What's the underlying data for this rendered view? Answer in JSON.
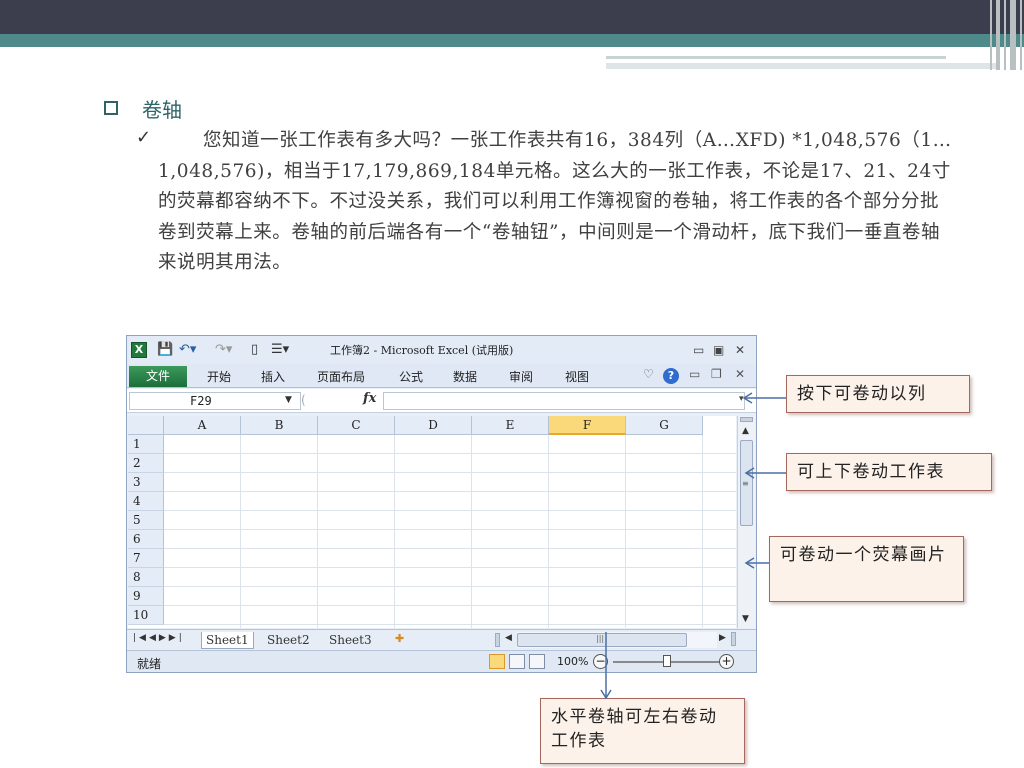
{
  "slide": {
    "title": "卷轴",
    "paragraph": "您知道一张工作表有多大吗？一张工作表共有16，384列（A…XFD) *1,048,576（1… 1,048,576)，相当于17,179,869,184单元格。这么大的一张工作表，不论是17、21、24寸的荧幕都容纳不下。不过没关系，我们可以利用工作簿视窗的卷轴，将工作表的各个部分分批卷到荧幕上来。卷轴的前后端各有一个“卷轴钮”，中间则是一个滑动杆，底下我们一垂直卷轴来说明其用法。",
    "check_glyph": "✓"
  },
  "excel": {
    "title": "工作簿2 - Microsoft Excel (试用版)",
    "logo": "X",
    "file_tab": "文件",
    "ribbon_tabs": [
      "开始",
      "插入",
      "页面布局",
      "公式",
      "数据",
      "审阅",
      "视图"
    ],
    "name_box": "F29",
    "fx_label": "fx",
    "columns": [
      "A",
      "B",
      "C",
      "D",
      "E",
      "F",
      "G"
    ],
    "selected_column": "F",
    "rows": [
      "1",
      "2",
      "3",
      "4",
      "5",
      "6",
      "7",
      "8",
      "9",
      "10"
    ],
    "sheet_tabs": [
      "Sheet1",
      "Sheet2",
      "Sheet3"
    ],
    "active_sheet": "Sheet1",
    "status": "就绪",
    "zoom": "100%",
    "zoom_level": 0.5
  },
  "callouts": {
    "column_scroll": "按下可卷动以列",
    "row_scroll": "可上下卷动工作表",
    "page_scroll": "可卷动一个荧幕画片",
    "horizontal_scroll": "水平卷轴可左右卷动工作表"
  },
  "colors": {
    "accent": "#2f6467",
    "excel_green": "#217346",
    "selected_header": "#f9d97a",
    "callout_bg": "#fcf2ea",
    "callout_border": "#a5685e"
  }
}
